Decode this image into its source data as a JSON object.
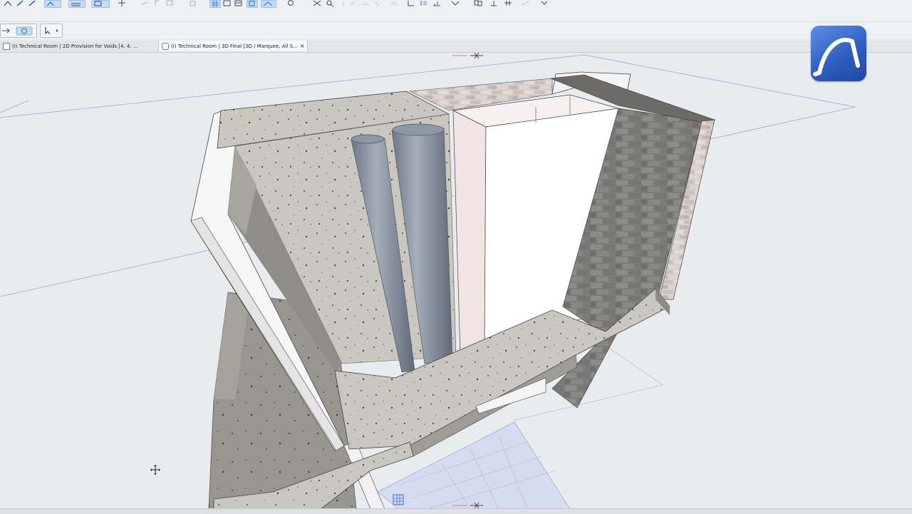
{
  "tabs": [
    {
      "label": "(I) Technical Room | 2D Provision for Voids [4. 4. ...",
      "active": false
    },
    {
      "label": "(I) Technical Room | 3D Final [3D / Marquee, All S...",
      "active": true,
      "close": "×"
    }
  ],
  "icons": {
    "app_logo": "archicad-logo-icon",
    "cursor": "move-cursor-icon",
    "grid_marker": "grid-icon"
  },
  "colors": {
    "accent": "#2f5fc2",
    "toolbar_bg": "#eef0f2",
    "viewport_bg": "#e9ecee",
    "selected_tool": "#c5dcf4"
  }
}
